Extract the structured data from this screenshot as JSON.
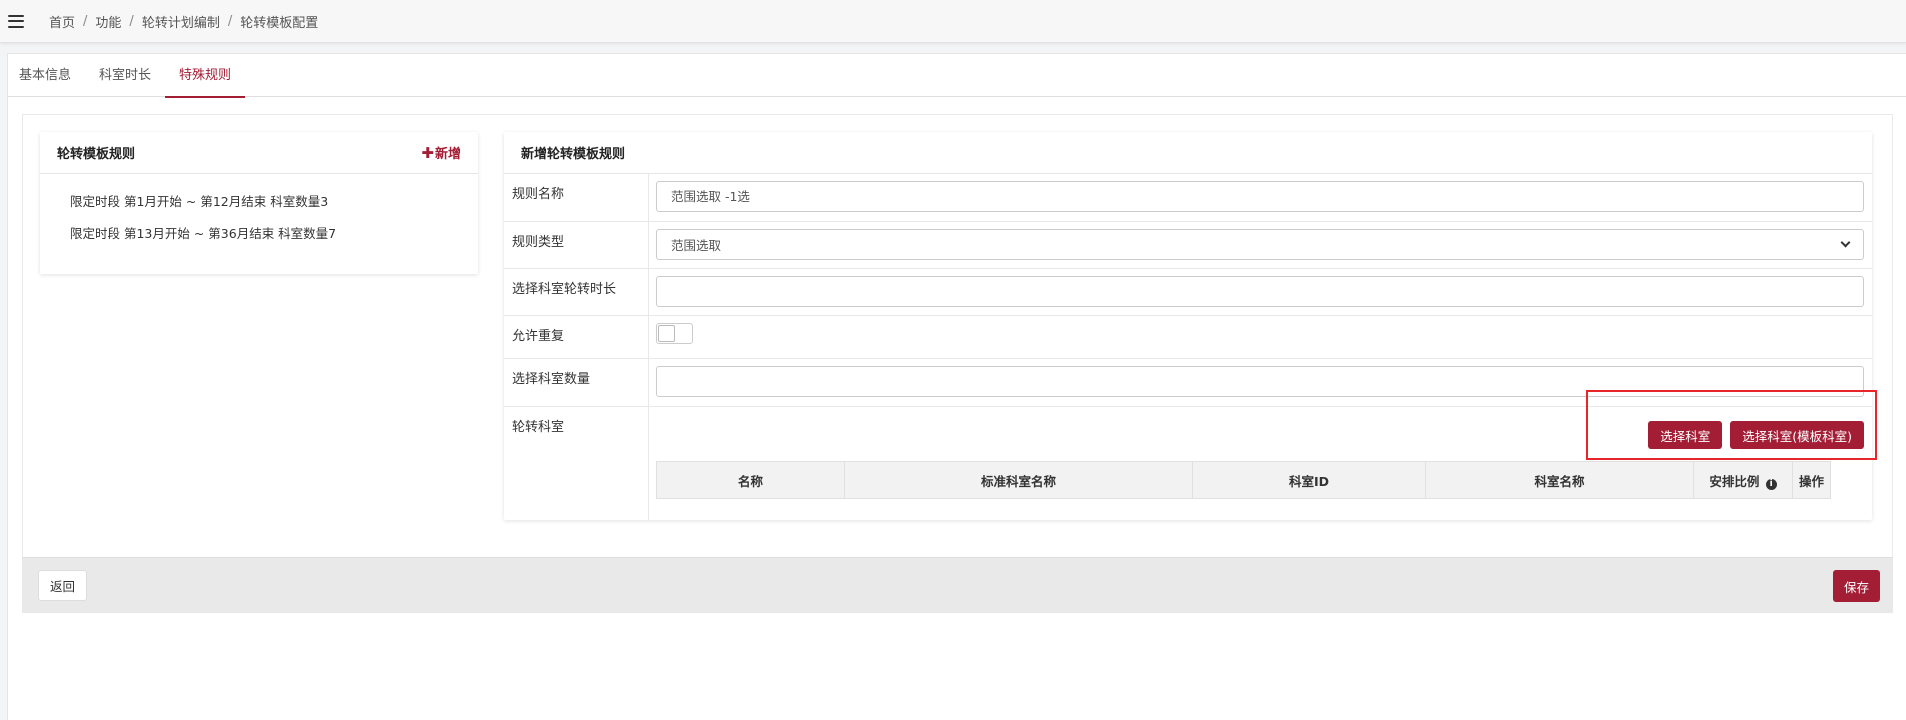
{
  "breadcrumb": [
    "首页",
    "功能",
    "轮转计划编制",
    "轮转模板配置"
  ],
  "tabs": [
    {
      "label": "基本信息",
      "active": false
    },
    {
      "label": "科室时长",
      "active": false
    },
    {
      "label": "特殊规则",
      "active": true
    }
  ],
  "left_card": {
    "title": "轮转模板规则",
    "add_label": "新增",
    "rules": [
      "限定时段 第1月开始 ~ 第12月结束 科室数量3",
      "限定时段 第13月开始 ~ 第36月结束 科室数量7"
    ]
  },
  "right_card": {
    "title": "新增轮转模板规则",
    "fields": {
      "rule_name": {
        "label": "规则名称",
        "value": "范围选取 -1选"
      },
      "rule_type": {
        "label": "规则类型",
        "value": "范围选取"
      },
      "duration": {
        "label": "选择科室轮转时长",
        "value": ""
      },
      "allow_repeat": {
        "label": "允许重复",
        "checked": false
      },
      "dept_count": {
        "label": "选择科室数量",
        "value": ""
      },
      "rotation_dept": {
        "label": "轮转科室"
      }
    },
    "buttons": {
      "select_dept": "选择科室",
      "select_template_dept": "选择科室(模板科室)"
    },
    "table_headers": [
      "名称",
      "标准科室名称",
      "科室ID",
      "科室名称",
      "安排比例",
      "操作"
    ]
  },
  "footer": {
    "back_label": "返回",
    "save_label": "保存"
  },
  "colors": {
    "primary": "#a31d35",
    "highlight": "#e8262a"
  }
}
